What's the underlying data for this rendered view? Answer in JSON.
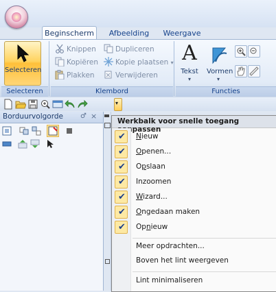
{
  "ribbon": {
    "tabs": [
      "Beginscherm",
      "Afbeelding",
      "Weergave"
    ],
    "select": {
      "label": "Selecteren"
    },
    "clipboard": {
      "cut": "Knippen",
      "copy": "Kopiëren",
      "paste": "Plakken",
      "duplicate": "Dupliceren",
      "paste_copy": "Kopie plaatsen",
      "delete": "Verwijderen"
    },
    "text_button": {
      "glyph": "A",
      "label": "Tekst"
    },
    "shapes_button": {
      "label": "Vormen"
    },
    "group_labels": {
      "select": "Selecteren",
      "clipboard": "Klembord",
      "functions": "Functies"
    }
  },
  "panel": {
    "title": "Borduurvolgorde",
    "pin": "♂",
    "close": "×"
  },
  "menu": {
    "title": "Werkbalk voor snelle toegang aanpassen",
    "items": [
      {
        "pre": "",
        "key": "N",
        "post": "ieuw",
        "checked": true
      },
      {
        "pre": "",
        "key": "O",
        "post": "penen...",
        "checked": true
      },
      {
        "pre": "O",
        "key": "p",
        "post": "slaan",
        "checked": true
      },
      {
        "pre": "Inzoomen",
        "key": "",
        "post": "",
        "checked": true
      },
      {
        "pre": "",
        "key": "W",
        "post": "izard...",
        "checked": true
      },
      {
        "pre": "",
        "key": "O",
        "post": "ngedaan maken",
        "checked": true
      },
      {
        "pre": "Op",
        "key": "n",
        "post": "ieuw",
        "checked": true
      }
    ],
    "more_commands": {
      "pre": "Meer opdrachten",
      "key": "",
      "post": "..."
    },
    "show_above": "Boven het lint weergeven",
    "minimize": "Lint minimaliseren",
    "check_glyph": "✔"
  },
  "colors": {
    "accent": "#ffd35f",
    "menu_check_bg": "#fde9a4"
  }
}
